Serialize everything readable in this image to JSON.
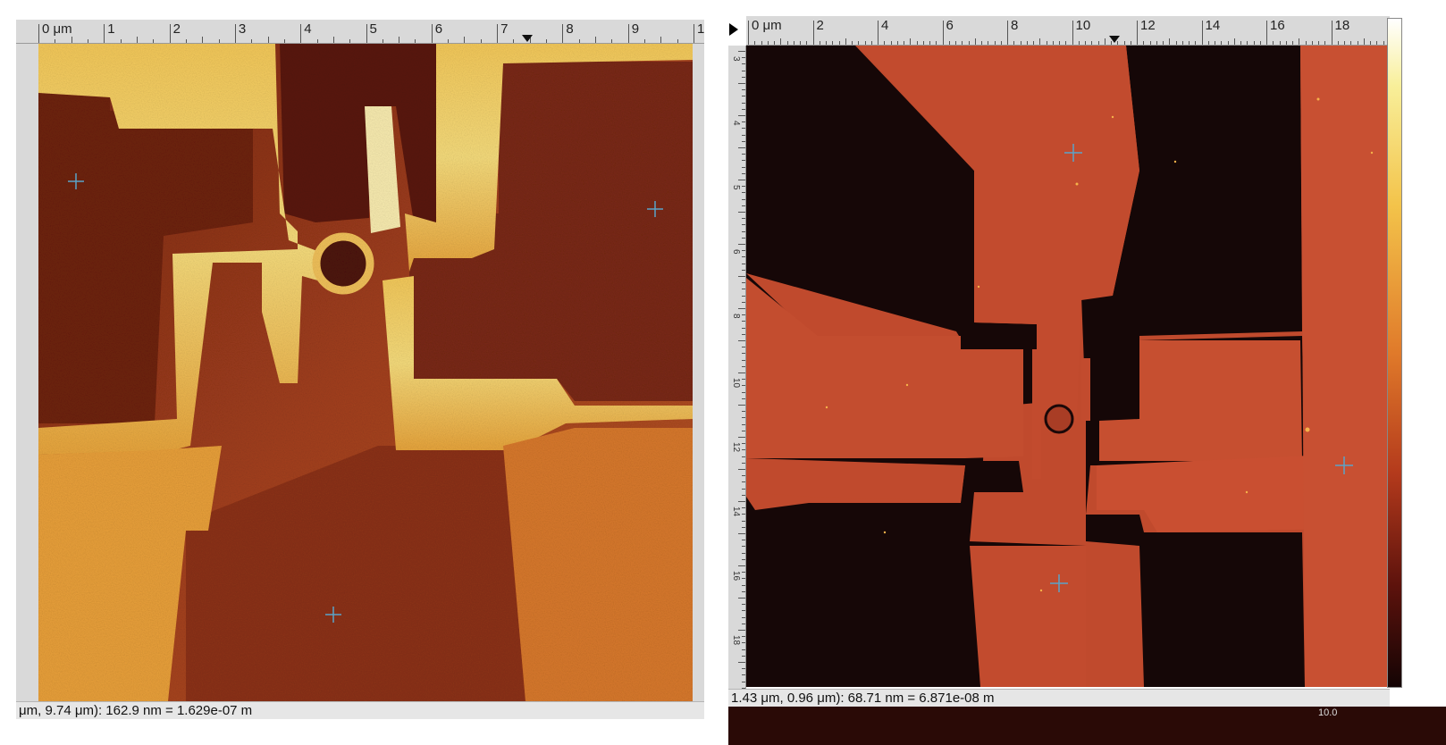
{
  "left_panel": {
    "ruler_labels": [
      "0 μm",
      "1",
      "2",
      "3",
      "4",
      "5",
      "6",
      "7",
      "8",
      "9",
      "1"
    ],
    "status_text": "μm, 9.74 μm): 162.9 nm = 1.629e-07 m"
  },
  "right_panel": {
    "ruler_labels": [
      "0 μm",
      "2",
      "4",
      "6",
      "8",
      "10",
      "12",
      "14",
      "16",
      "18"
    ],
    "vertical_ruler_labels": [
      "3",
      "4",
      "5",
      "6",
      "8",
      "10",
      "12",
      "14",
      "16",
      "18"
    ],
    "status_text": "1.43 μm, 0.96 μm): 68.71 nm = 6.871e-08 m",
    "colorbar_caption": "10.0"
  },
  "colors": {
    "left_background": "#a8421f",
    "left_dark": "#4a120c",
    "left_bright": "#f3d470",
    "right_background": "#bf4a2c",
    "right_dark": "#140606",
    "marker": "#5aa3c8"
  }
}
